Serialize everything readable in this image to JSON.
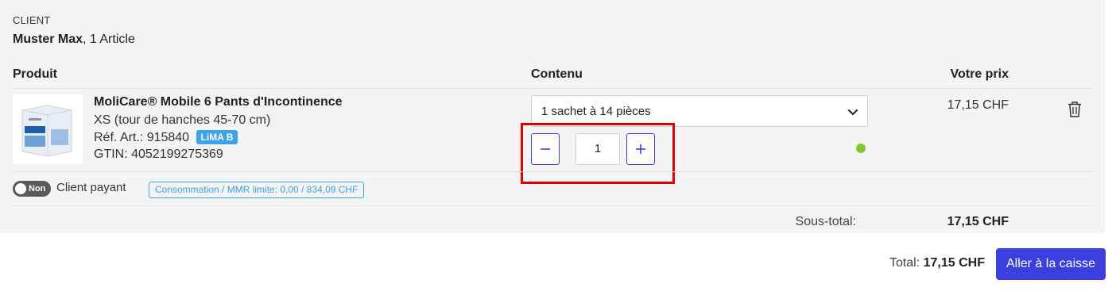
{
  "client": {
    "section_label": "CLIENT",
    "name": "Muster Max",
    "article_count": ", 1 Article"
  },
  "table": {
    "headers": {
      "product": "Produit",
      "content": "Contenu",
      "price": "Votre prix"
    },
    "row": {
      "product_name": "MoliCare® Mobile 6 Pants d'Incontinence",
      "size": "XS (tour de hanches 45-70 cm)",
      "ref_label": "Réf. Art.: 915840",
      "ref_badge": "LiMA B",
      "gtin": "GTIN: 4052199275369",
      "package_select": "1 sachet à 14 pièces",
      "quantity": "1",
      "availability": "in-stock",
      "price": "17,15 CHF"
    }
  },
  "payer": {
    "toggle_label": "Non",
    "label": "Client payant",
    "limit_badge": "Consommation / MMR limite: 0,00 / 834,09 CHF"
  },
  "subtotal": {
    "label": "Sous-total:",
    "value": "17,15 CHF"
  },
  "footer": {
    "total_label": "Total: ",
    "total_value": "17,15 CHF",
    "checkout_button": "Aller à la caisse"
  },
  "colors": {
    "accent": "#3b3fe0",
    "badge": "#3da3e8",
    "highlight": "#e00000",
    "in_stock": "#7ccd2a"
  },
  "icons": {
    "select_chevron": "chevron-down-icon",
    "minus": "minus-icon",
    "plus": "plus-icon",
    "delete": "trash-icon",
    "stock": "status-dot-icon"
  }
}
